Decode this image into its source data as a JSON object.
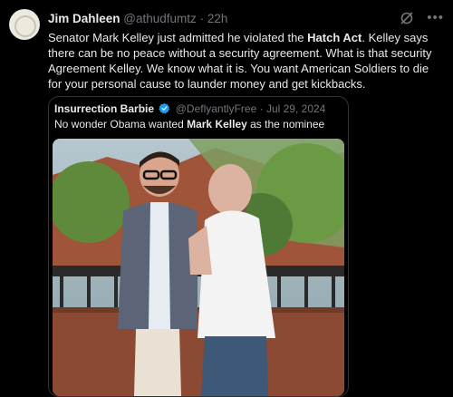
{
  "tweet": {
    "author_name": "Jim Dahleen",
    "handle": "@athudfumtz",
    "separator": "·",
    "time": "22h",
    "grok_icon": "grok-icon",
    "more_icon": "more-dots-icon",
    "text": {
      "p1": "Senator Mark Kelley just admitted he violated the ",
      "b1": "Hatch Act",
      "p2": ". Kelley says there can be no peace without a security agreement. What is that security Agreement Kelley. We know what it is. You want American Soldiers to die for your personal cause to launder money and get kickbacks."
    }
  },
  "quote": {
    "author_name": "Insurrection Barbie",
    "verified_icon": "verified-badge-icon",
    "handle": "@DeflyantlyFree",
    "separator": "·",
    "date": "Jul 29, 2024",
    "text": {
      "p1": "No wonder Obama wanted ",
      "b1": "Mark Kelley",
      "p2": " as the nominee"
    },
    "image": "photo of two men standing on a balcony"
  },
  "colors": {
    "background": "#000000",
    "text": "#e7e9ea",
    "secondary": "#71767b",
    "border": "#2f3336",
    "verified": "#1d9bf0"
  }
}
